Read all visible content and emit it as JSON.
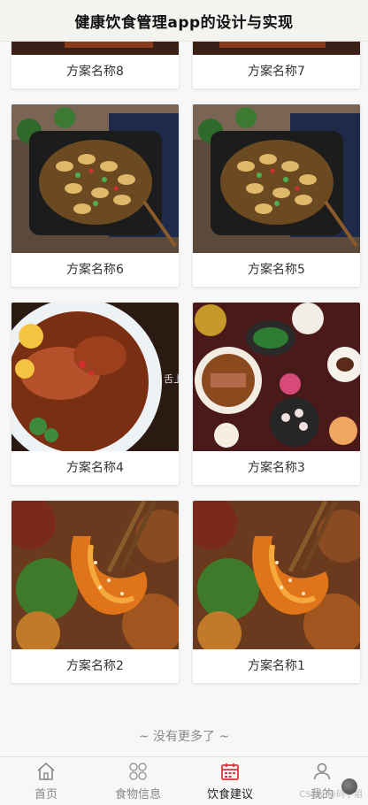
{
  "header": {
    "title": "健康饮食管理app的设计与实现"
  },
  "plans": [
    {
      "name": "方案名称8"
    },
    {
      "name": "方案名称7"
    },
    {
      "name": "方案名称6"
    },
    {
      "name": "方案名称5"
    },
    {
      "name": "方案名称4"
    },
    {
      "name": "方案名称3"
    },
    {
      "name": "方案名称2"
    },
    {
      "name": "方案名称1"
    }
  ],
  "end_tip": "~ 没有更多了 ~",
  "tabbar": [
    {
      "label": "首页",
      "icon": "home-icon"
    },
    {
      "label": "食物信息",
      "icon": "grid-flower-icon"
    },
    {
      "label": "饮食建议",
      "icon": "calendar-icon",
      "active": true
    },
    {
      "label": "我的",
      "icon": "user-icon"
    }
  ],
  "watermark": "CSDN @码学姐",
  "colors": {
    "active": "#d9363e",
    "inactive": "#888888"
  }
}
